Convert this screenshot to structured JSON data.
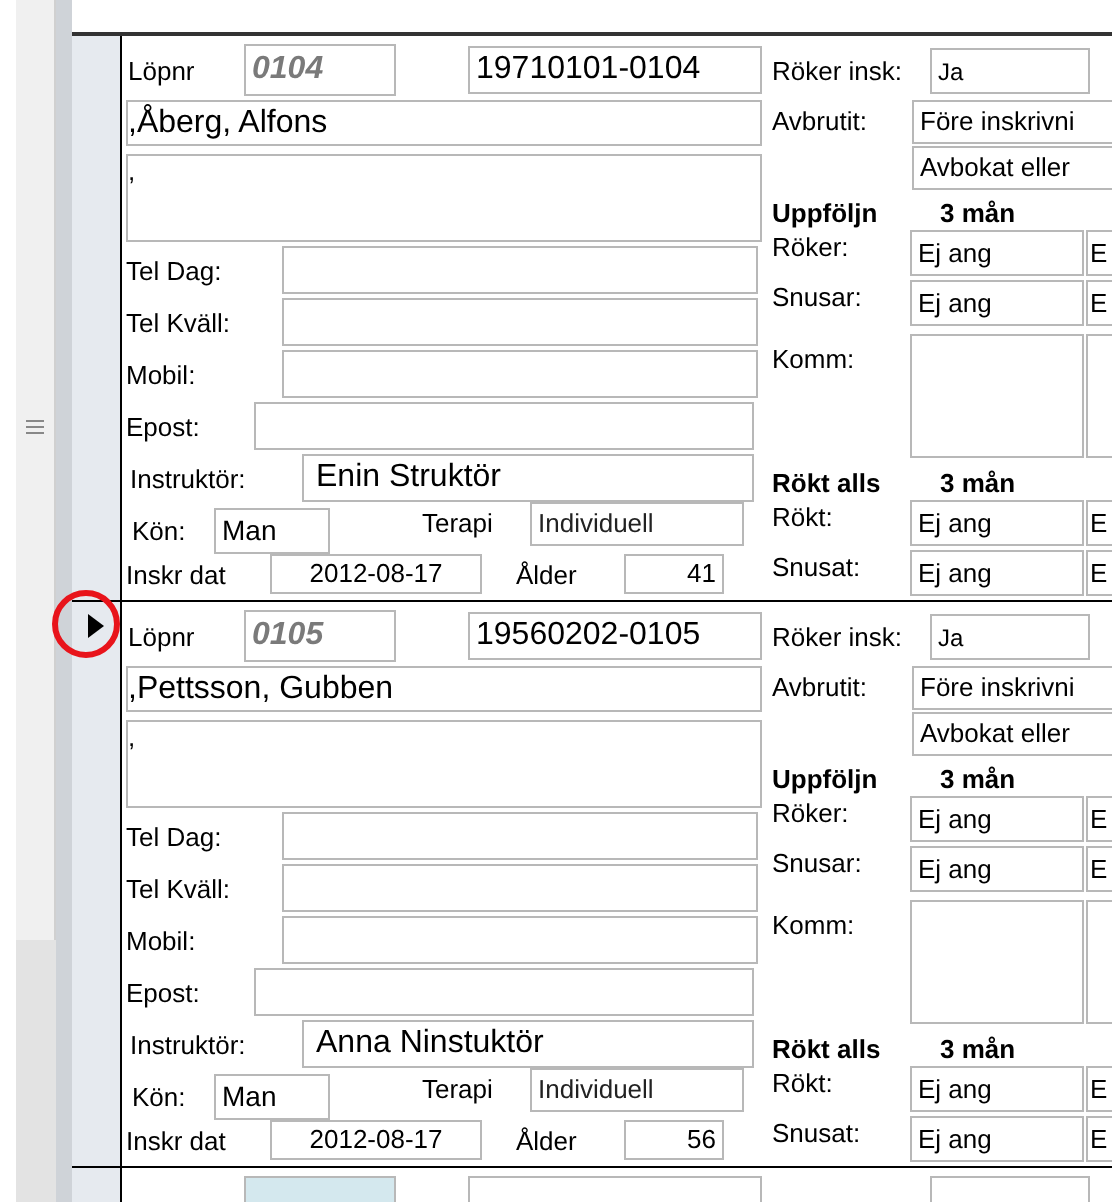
{
  "records": [
    {
      "selected": false,
      "lopnr_label": "Löpnr",
      "lopnr": "0104",
      "personnummer": "19710101-0104",
      "name": ",Åberg, Alfons",
      "address": ",",
      "contacts": [
        {
          "kind": "phone",
          "label": "Tel Dag:"
        },
        {
          "kind": "phone",
          "label": "Tel Kväll:"
        },
        {
          "kind": "phone",
          "label": "Mobil:"
        },
        {
          "kind": "email",
          "label": "Epost:"
        }
      ],
      "instructor": {
        "label": "Instruktör:",
        "value": "Enin Struktör"
      },
      "gender": {
        "label": "Kön:",
        "value": "Man"
      },
      "therapy": {
        "label": "Terapi",
        "value": "Individuell"
      },
      "enrolled": {
        "label": "Inskr dat",
        "value": "2012-08-17"
      },
      "age": {
        "label": "Ålder",
        "value": "41"
      },
      "smoker_at_intake": {
        "label": "Röker insk:",
        "value": "Ja"
      },
      "aborted": {
        "label": "Avbrutit:",
        "values": [
          "Före inskrivni",
          "Avbokat eller"
        ]
      },
      "followup": {
        "heading": "Uppföljn",
        "period": "3 mån",
        "rows": [
          {
            "label": "Röker:",
            "values": [
              "Ej ang",
              "E"
            ]
          },
          {
            "label": "Snusar:",
            "values": [
              "Ej ang",
              "E"
            ]
          }
        ],
        "comment_label": "Komm:"
      },
      "smoked_at_all": {
        "heading": "Rökt alls",
        "period": "3 mån",
        "rows": [
          {
            "label": "Rökt:",
            "values": [
              "Ej ang",
              "E"
            ]
          },
          {
            "label": "Snusat:",
            "values": [
              "Ej ang",
              "E"
            ]
          }
        ]
      }
    },
    {
      "selected": true,
      "lopnr_label": "Löpnr",
      "lopnr": "0105",
      "personnummer": "19560202-0105",
      "name": ",Pettsson, Gubben",
      "address": ",",
      "contacts": [
        {
          "kind": "phone",
          "label": "Tel Dag:"
        },
        {
          "kind": "phone",
          "label": "Tel Kväll:"
        },
        {
          "kind": "phone",
          "label": "Mobil:"
        },
        {
          "kind": "email",
          "label": "Epost:"
        }
      ],
      "instructor": {
        "label": "Instruktör:",
        "value": "Anna Ninstuktör"
      },
      "gender": {
        "label": "Kön:",
        "value": "Man"
      },
      "therapy": {
        "label": "Terapi",
        "value": "Individuell"
      },
      "enrolled": {
        "label": "Inskr dat",
        "value": "2012-08-17"
      },
      "age": {
        "label": "Ålder",
        "value": "56"
      },
      "smoker_at_intake": {
        "label": "Röker insk:",
        "value": "Ja"
      },
      "aborted": {
        "label": "Avbrutit:",
        "values": [
          "Före inskrivni",
          "Avbokat eller"
        ]
      },
      "followup": {
        "heading": "Uppföljn",
        "period": "3 mån",
        "rows": [
          {
            "label": "Röker:",
            "values": [
              "Ej ang",
              "E"
            ]
          },
          {
            "label": "Snusar:",
            "values": [
              "Ej ang",
              "E"
            ]
          }
        ],
        "comment_label": "Komm:"
      },
      "smoked_at_all": {
        "heading": "Rökt alls",
        "period": "3 mån",
        "rows": [
          {
            "label": "Rökt:",
            "values": [
              "Ej ang",
              "E"
            ]
          },
          {
            "label": "Snusat:",
            "values": [
              "Ej ang",
              "E"
            ]
          }
        ]
      }
    }
  ]
}
